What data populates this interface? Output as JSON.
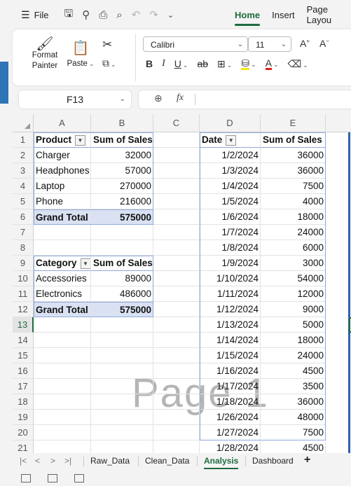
{
  "menubar": {
    "file_label": "File",
    "tabs": [
      "Home",
      "Insert",
      "Page Layou"
    ]
  },
  "ribbon": {
    "format_painter": "Format Painter",
    "paste": "Paste",
    "font_name": "Calibri",
    "font_size": "11"
  },
  "formula_bar": {
    "name_box": "F13",
    "fx": "fx",
    "formula": ""
  },
  "columns": [
    "A",
    "B",
    "C",
    "D",
    "E"
  ],
  "rows": [
    "1",
    "2",
    "3",
    "4",
    "5",
    "6",
    "7",
    "8",
    "9",
    "10",
    "11",
    "12",
    "13",
    "14",
    "15",
    "16",
    "17",
    "18",
    "19",
    "20",
    "21"
  ],
  "pivot1": {
    "header": [
      "Product",
      "Sum of Sales"
    ],
    "rows": [
      [
        "Charger",
        "32000"
      ],
      [
        "Headphones",
        "57000"
      ],
      [
        "Laptop",
        "270000"
      ],
      [
        "Phone",
        "216000"
      ]
    ],
    "total": [
      "Grand Total",
      "575000"
    ]
  },
  "pivot2": {
    "header": [
      "Category",
      "Sum of Sales"
    ],
    "rows": [
      [
        "Accessories",
        "89000"
      ],
      [
        "Electronics",
        "486000"
      ]
    ],
    "total": [
      "Grand Total",
      "575000"
    ]
  },
  "pivot3": {
    "header": [
      "Date",
      "Sum of Sales"
    ],
    "rows": [
      [
        "1/2/2024",
        "36000"
      ],
      [
        "1/3/2024",
        "36000"
      ],
      [
        "1/4/2024",
        "7500"
      ],
      [
        "1/5/2024",
        "4000"
      ],
      [
        "1/6/2024",
        "18000"
      ],
      [
        "1/7/2024",
        "24000"
      ],
      [
        "1/8/2024",
        "6000"
      ],
      [
        "1/9/2024",
        "3000"
      ],
      [
        "1/10/2024",
        "54000"
      ],
      [
        "1/11/2024",
        "12000"
      ],
      [
        "1/12/2024",
        "9000"
      ],
      [
        "1/13/2024",
        "5000"
      ],
      [
        "1/14/2024",
        "18000"
      ],
      [
        "1/15/2024",
        "24000"
      ],
      [
        "1/16/2024",
        "4500"
      ],
      [
        "1/17/2024",
        "3500"
      ],
      [
        "1/18/2024",
        "36000"
      ],
      [
        "1/26/2024",
        "48000"
      ],
      [
        "1/27/2024",
        "7500"
      ],
      [
        "1/28/2024",
        "4500"
      ]
    ]
  },
  "watermark": "Page 1",
  "sheet_tabs": [
    "Raw_Data",
    "Clean_Data",
    "Analysis",
    "Dashboard"
  ],
  "active_sheet": "Analysis",
  "selected_row": "13"
}
